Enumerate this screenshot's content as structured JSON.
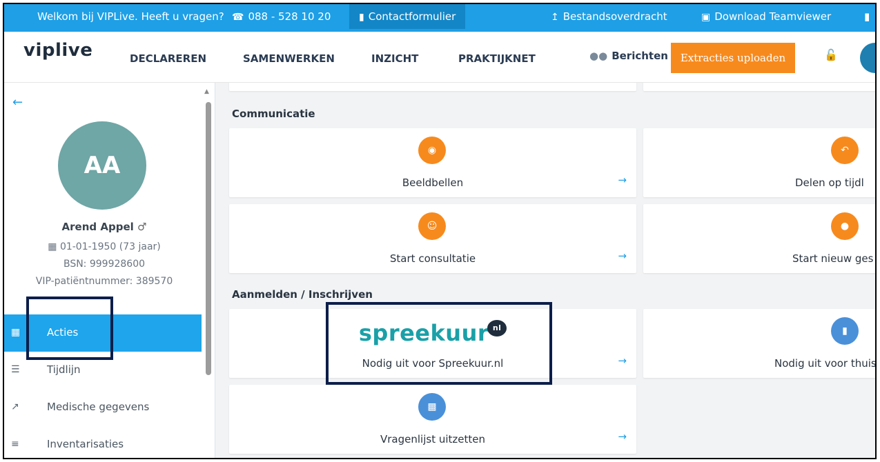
{
  "topbar": {
    "welcome": "Welkom bij VIPLive. Heeft u vragen?",
    "phone": "088 - 528 10 20",
    "contact": "Contactformulier",
    "transfer": "Bestandsoverdracht",
    "teamviewer": "Download Teamviewer"
  },
  "nav": {
    "logo": "viplive",
    "links": [
      "DECLAREREN",
      "SAMENWERKEN",
      "INZICHT",
      "PRAKTIJKNET"
    ],
    "messages": "Berichten",
    "extract_button": "Extracties uploaden"
  },
  "patient": {
    "initials": "AA",
    "name": "Arend Appel",
    "gender_symbol": "♂",
    "dob": "01-01-1950  (73 jaar)",
    "bsn": "BSN: 999928600",
    "vip_number": "VIP-patiëntnummer: 389570"
  },
  "sidebar": {
    "items": [
      {
        "label": "Acties",
        "icon": "calendar-plus-icon",
        "active": true
      },
      {
        "label": "Tijdlijn",
        "icon": "list-icon",
        "active": false
      },
      {
        "label": "Medische gegevens",
        "icon": "chart-line-icon",
        "active": false
      },
      {
        "label": "Inventarisaties",
        "icon": "list-ol-icon",
        "active": false
      }
    ]
  },
  "main": {
    "sections": [
      {
        "title": "Communicatie",
        "cards": [
          {
            "label": "Beeldbellen",
            "icon": "webcam-icon",
            "color": "#f78a1d"
          },
          {
            "label": "Delen op tijdl",
            "icon": "reply-icon",
            "color": "#f78a1d"
          },
          {
            "label": "Start consultatie",
            "icon": "users-chat-icon",
            "color": "#f78a1d"
          },
          {
            "label": "Start nieuw ges",
            "icon": "comment-icon",
            "color": "#f78a1d"
          }
        ]
      },
      {
        "title": "Aanmelden / Inschrijven",
        "cards": [
          {
            "label": "Nodig uit voor Spreekuur.nl",
            "logo_text": "spreekuur",
            "logo_badge": "nl"
          },
          {
            "label": "Nodig uit voor thuis",
            "icon": "clipboard-icon",
            "color": "#4a90d9"
          },
          {
            "label": "Vragenlijst uitzetten",
            "icon": "bar-chart-icon",
            "color": "#4a90d9"
          }
        ]
      }
    ]
  },
  "colors": {
    "brand_blue": "#1e9fe6",
    "accent_orange": "#f78a1d",
    "highlight_border": "#0c1e4a"
  }
}
